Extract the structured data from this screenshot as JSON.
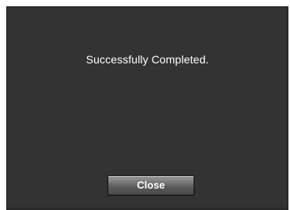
{
  "dialog": {
    "message": "Successfully Completed.",
    "close_label": "Close"
  },
  "colors": {
    "dialog_background": "#333333",
    "message_text": "#ffffff",
    "button_gradient_top": "#9a9a9a",
    "button_gradient_bottom": "#4a4a4a"
  }
}
